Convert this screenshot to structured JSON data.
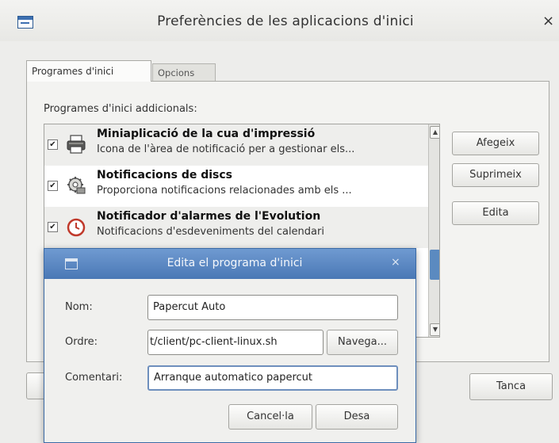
{
  "window": {
    "title": "Preferències de les aplicacions d'inici",
    "close_glyph": "×"
  },
  "tabs": [
    {
      "label": "Programes d'inici",
      "active": true
    },
    {
      "label": "Opcions",
      "active": false
    }
  ],
  "list": {
    "label": "Programes d'inici addicionals:",
    "items": [
      {
        "name": "Miniaplicació de la cua d'impressió",
        "description": "Icona de l'àrea de notificació per a gestionar els...",
        "checked": true,
        "icon": "printer-icon"
      },
      {
        "name": "Notificacions de discs",
        "description": "Proporciona notificacions relacionades amb els ...",
        "checked": true,
        "icon": "disk-gear-icon"
      },
      {
        "name": "Notificador d'alarmes de l'Evolution",
        "description": "Notificacions d'esdeveniments del calendari",
        "checked": true,
        "icon": "alarm-clock-icon"
      }
    ]
  },
  "buttons": {
    "add": "Afegeix",
    "remove": "Suprimeix",
    "edit": "Edita",
    "close": "Tanca"
  },
  "dialog": {
    "title": "Edita el programa d'inici",
    "close_glyph": "×",
    "name_label": "Nom:",
    "name_value": "Papercut Auto",
    "command_label": "Ordre:",
    "command_value": "t/client/pc-client-linux.sh",
    "browse_label": "Navega...",
    "comment_label": "Comentari:",
    "comment_value": "Arranque automatico papercut",
    "cancel_label": "Cancel·la",
    "save_label": "Desa"
  },
  "colors": {
    "accent": "#4a78b5",
    "window_bg": "#ededeb",
    "list_bg": "#ffffff"
  }
}
